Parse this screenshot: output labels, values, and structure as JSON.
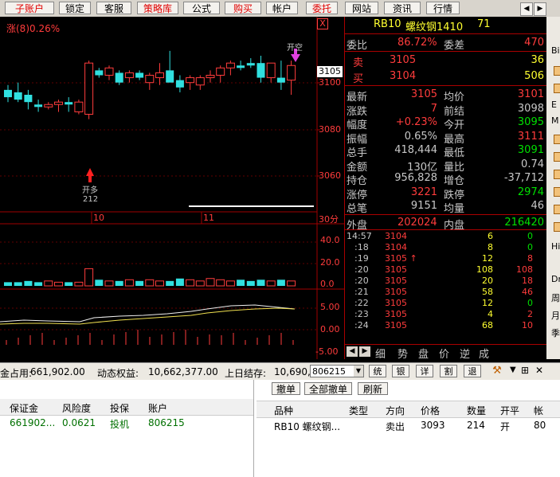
{
  "toolbar": {
    "buttons": [
      {
        "label": "子账户",
        "red": true
      },
      {
        "label": "锁定",
        "red": false
      },
      {
        "label": "客服",
        "red": false
      },
      {
        "label": "策略库",
        "red": true
      },
      {
        "label": "公式",
        "red": false
      },
      {
        "label": "购买",
        "red": true
      },
      {
        "label": "帐户",
        "red": false
      },
      {
        "label": "委托",
        "red": true
      },
      {
        "label": "网站",
        "red": false
      },
      {
        "label": "资讯",
        "red": false
      },
      {
        "label": "行情",
        "red": false
      }
    ],
    "nav_left": "◀",
    "nav_right": "▶"
  },
  "chart": {
    "indicator_label": "涨(8)0.26%",
    "price_ticks": [
      "3100",
      "3080",
      "3060"
    ],
    "current_price_tag": "3105",
    "vol_ticks": [
      "40.0",
      "20.0",
      "0.0"
    ],
    "osc_ticks": [
      "5.00",
      "0.00",
      "-5.00"
    ],
    "time_labels": [
      "10",
      "11"
    ],
    "period_label": "30分",
    "arrow_up_label": "开多",
    "arrow_up_value": "212",
    "arrow_down_label": "开空",
    "x_label": "X",
    "chart_data": {
      "type": "candlestick",
      "candles": [
        {
          "o": 3098,
          "h": 3100,
          "l": 3093,
          "c": 3095
        },
        {
          "o": 3097,
          "h": 3101,
          "l": 3093,
          "c": 3094
        },
        {
          "o": 3096,
          "h": 3098,
          "l": 3090,
          "c": 3093
        },
        {
          "o": 3092,
          "h": 3094,
          "l": 3089,
          "c": 3091
        },
        {
          "o": 3091,
          "h": 3093,
          "l": 3090,
          "c": 3092
        },
        {
          "o": 3092,
          "h": 3094,
          "l": 3089,
          "c": 3093
        },
        {
          "o": 3093,
          "h": 3095,
          "l": 3089,
          "c": 3092
        },
        {
          "o": 3089,
          "h": 3094,
          "l": 3088,
          "c": 3093
        },
        {
          "o": 3088,
          "h": 3110,
          "l": 3086,
          "c": 3109
        },
        {
          "o": 3106,
          "h": 3107,
          "l": 3103,
          "c": 3104
        },
        {
          "o": 3104,
          "h": 3108,
          "l": 3102,
          "c": 3107
        },
        {
          "o": 3105,
          "h": 3106,
          "l": 3100,
          "c": 3101
        },
        {
          "o": 3103,
          "h": 3106,
          "l": 3101,
          "c": 3105
        },
        {
          "o": 3105,
          "h": 3106,
          "l": 3102,
          "c": 3103
        },
        {
          "o": 3101,
          "h": 3105,
          "l": 3098,
          "c": 3104
        },
        {
          "o": 3103,
          "h": 3109,
          "l": 3100,
          "c": 3105
        },
        {
          "o": 3106,
          "h": 3114,
          "l": 3102,
          "c": 3101
        },
        {
          "o": 3102,
          "h": 3104,
          "l": 3097,
          "c": 3099
        },
        {
          "o": 3101,
          "h": 3104,
          "l": 3098,
          "c": 3103
        },
        {
          "o": 3100,
          "h": 3104,
          "l": 3098,
          "c": 3103
        },
        {
          "o": 3103,
          "h": 3106,
          "l": 3101,
          "c": 3104
        },
        {
          "o": 3104,
          "h": 3108,
          "l": 3101,
          "c": 3107
        },
        {
          "o": 3107,
          "h": 3110,
          "l": 3104,
          "c": 3109
        },
        {
          "o": 3108,
          "h": 3110,
          "l": 3106,
          "c": 3107
        },
        {
          "o": 3109,
          "h": 3111,
          "l": 3107,
          "c": 3108
        },
        {
          "o": 3109,
          "h": 3112,
          "l": 3101,
          "c": 3103
        },
        {
          "o": 3103,
          "h": 3109,
          "l": 3101,
          "c": 3109
        },
        {
          "o": 3103,
          "h": 3110,
          "l": 3098,
          "c": 3101
        },
        {
          "o": 3102,
          "h": 3110,
          "l": 3096,
          "c": 3108
        }
      ],
      "price_range": [
        3048,
        3128
      ],
      "volumes": [
        3,
        3,
        4,
        3,
        4,
        3,
        3,
        3,
        14,
        5,
        4,
        4,
        5,
        4,
        5,
        4,
        4,
        6,
        5,
        4,
        6,
        5,
        4,
        5,
        4,
        5,
        4,
        5,
        4
      ],
      "volume_range": [
        0,
        48
      ]
    }
  },
  "quote": {
    "contract": "RB10",
    "name": "螺纹钢1410",
    "code": "71",
    "weibi_label": "委比",
    "weibi": "86.72%",
    "weicha_label": "委差",
    "weicha": "470",
    "sell_label": "卖",
    "sell_price": "3105",
    "sell_vol": "36",
    "buy_label": "买",
    "buy_price": "3104",
    "buy_vol": "506",
    "stats": [
      {
        "l1": "最新",
        "v1": "3105",
        "c1": "r",
        "l2": "均价",
        "v2": "3101",
        "c2": "r"
      },
      {
        "l1": "涨跌",
        "v1": "7",
        "c1": "r",
        "l2": "前结",
        "v2": "3098",
        "c2": "w"
      },
      {
        "l1": "幅度",
        "v1": "+0.23%",
        "c1": "r",
        "l2": "今开",
        "v2": "3095",
        "c2": "g"
      },
      {
        "l1": "振幅",
        "v1": "0.65%",
        "c1": "w",
        "l2": "最高",
        "v2": "3111",
        "c2": "r"
      },
      {
        "l1": "总手",
        "v1": "418,444",
        "c1": "w",
        "l2": "最低",
        "v2": "3091",
        "c2": "g"
      },
      {
        "l1": "金额",
        "v1": "130亿",
        "c1": "w",
        "l2": "量比",
        "v2": "0.74",
        "c2": "w"
      },
      {
        "l1": "持仓",
        "v1": "956,828",
        "c1": "w",
        "l2": "增仓",
        "v2": "-37,712",
        "c2": "w"
      },
      {
        "l1": "涨停",
        "v1": "3221",
        "c1": "r",
        "l2": "跌停",
        "v2": "2974",
        "c2": "g"
      },
      {
        "l1": "总笔",
        "v1": "9151",
        "c1": "w",
        "l2": "均量",
        "v2": "46",
        "c2": "w"
      }
    ],
    "waipan_label": "外盘",
    "waipan": "202024",
    "neipan_label": "内盘",
    "neipan": "216420",
    "ticks": [
      {
        "t": "14:57",
        "p": "3104",
        "v": "6",
        "d": "0",
        "dc": "g"
      },
      {
        "t": ":18",
        "p": "3104",
        "v": "8",
        "d": "0",
        "dc": "g"
      },
      {
        "t": ":19",
        "p": "3105 ↑",
        "v": "12",
        "d": "8",
        "dc": "r"
      },
      {
        "t": ":20",
        "p": "3105",
        "v": "108",
        "d": "108",
        "dc": "r"
      },
      {
        "t": ":20",
        "p": "3105",
        "v": "20",
        "d": "18",
        "dc": "r"
      },
      {
        "t": ":21",
        "p": "3105",
        "v": "58",
        "d": "46",
        "dc": "r"
      },
      {
        "t": ":22",
        "p": "3105",
        "v": "12",
        "d": "0",
        "dc": "g"
      },
      {
        "t": ":23",
        "p": "3105",
        "v": "4",
        "d": "2",
        "dc": "r"
      },
      {
        "t": ":24",
        "p": "3105",
        "v": "68",
        "d": "10",
        "dc": "r"
      }
    ],
    "tabs": [
      "细",
      "势",
      "盘",
      "价",
      "逆",
      "成"
    ]
  },
  "side": {
    "labels": [
      "Bi",
      "Hi",
      "Dr",
      "周",
      "月",
      "季"
    ],
    "letter_items": [
      "E",
      "M"
    ]
  },
  "account": {
    "occupied_label": "金占用:",
    "occupied": "661,902.00",
    "equity_label": "动态权益:",
    "equity": "10,662,377.00",
    "prev_label": "上日结存:",
    "prev": "10,690,3",
    "account_select": "806215",
    "small_buttons": [
      "统",
      "银",
      "详",
      "割",
      "退"
    ],
    "pin": "⊞",
    "close": "✕"
  },
  "actions": {
    "cancel": "撤单",
    "cancel_all": "全部撤单",
    "refresh": "刷新"
  },
  "left_table": {
    "headers": [
      "保证金",
      "风险度",
      "投保",
      "账户"
    ],
    "row": [
      "661902...",
      "0.0621",
      "投机",
      "806215"
    ]
  },
  "right_table": {
    "headers": [
      "品种",
      "类型",
      "方向",
      "价格",
      "数量",
      "开平",
      "帐"
    ],
    "row": [
      "RB10 螺纹钢...",
      "",
      "卖出",
      "3093",
      "214",
      "开",
      "80"
    ]
  }
}
